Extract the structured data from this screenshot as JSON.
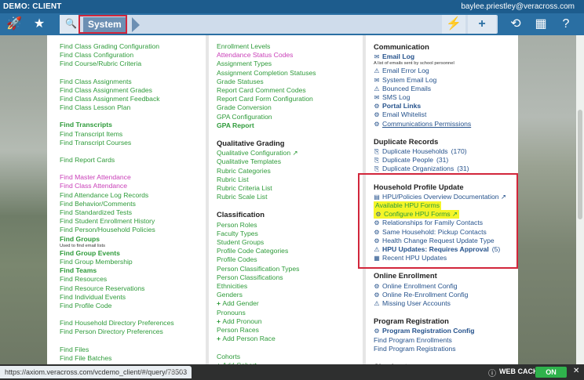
{
  "topbar": {
    "client": "DEMO: CLIENT",
    "user": "baylee.priestley@veracross.com"
  },
  "nav": {
    "left_icons": [
      {
        "name": "rocket-icon",
        "glyph": "🚀"
      },
      {
        "name": "star-icon",
        "glyph": "★"
      }
    ],
    "search_icon": "🔍",
    "system_label": "System",
    "right_buttons": [
      {
        "name": "lightning-icon",
        "glyph": "⚡"
      },
      {
        "name": "plus-icon",
        "glyph": "+"
      }
    ],
    "right_icons": [
      {
        "name": "history-icon",
        "glyph": "⟲"
      },
      {
        "name": "dashboard-grid-icon",
        "glyph": "▦"
      },
      {
        "name": "help-icon",
        "glyph": "?"
      }
    ]
  },
  "col1": [
    {
      "text": "Find Class Grading Configuration"
    },
    {
      "text": "Find Class Configuration"
    },
    {
      "text": "Find Course/Rubric Criteria"
    },
    {
      "gap": true
    },
    {
      "text": "Find Class Assignments"
    },
    {
      "text": "Find Class Assignment Grades"
    },
    {
      "text": "Find Class Assignment Feedback"
    },
    {
      "text": "Find Class Lesson Plan"
    },
    {
      "gap": true
    },
    {
      "text": "Find Transcripts",
      "bold": true
    },
    {
      "text": "Find Transcript Items"
    },
    {
      "text": "Find Transcript Courses"
    },
    {
      "gap": true
    },
    {
      "text": "Find Report Cards"
    },
    {
      "gap": true
    },
    {
      "text": "Find Master Attendance",
      "magenta": true
    },
    {
      "text": "Find Class Attendance",
      "magenta": true
    },
    {
      "text": "Find Attendance Log Records"
    },
    {
      "text": "Find Behavior/Comments"
    },
    {
      "text": "Find Standardized Tests"
    },
    {
      "text": "Find Student Enrollment History"
    },
    {
      "text": "Find Person/Household Policies"
    },
    {
      "text": "Find Groups",
      "bold": true
    },
    {
      "note": "Used to find email lists"
    },
    {
      "text": "Find Group Events",
      "bold": true
    },
    {
      "text": "Find Group Membership"
    },
    {
      "text": "Find Teams",
      "bold": true
    },
    {
      "text": "Find Resources"
    },
    {
      "text": "Find Resource Reservations"
    },
    {
      "text": "Find Individual Events"
    },
    {
      "text": "Find Profile Code"
    },
    {
      "gap": true
    },
    {
      "text": "Find Household Directory Preferences"
    },
    {
      "text": "Find Person Directory Preferences"
    },
    {
      "gap": true
    },
    {
      "text": "Find Files"
    },
    {
      "text": "Find File Batches"
    }
  ],
  "col2": [
    {
      "text": "Enrollment Levels"
    },
    {
      "text": "Attendance Status Codes",
      "magenta": true
    },
    {
      "text": "Assignment Types"
    },
    {
      "text": "Assignment Completion Statuses"
    },
    {
      "text": "Grade Statuses"
    },
    {
      "text": "Report Card Comment Codes"
    },
    {
      "text": "Report Card Form Configuration"
    },
    {
      "text": "Grade Conversion"
    },
    {
      "text": "GPA Configuration"
    },
    {
      "text": "GPA Report",
      "bold": true
    },
    {
      "gap": true
    },
    {
      "header": "Qualitative Grading"
    },
    {
      "text": "Qualitative Configuration",
      "ext": true
    },
    {
      "text": "Qualitative Templates"
    },
    {
      "text": "Rubric Categories"
    },
    {
      "text": "Rubric List"
    },
    {
      "text": "Rubric Criteria List"
    },
    {
      "text": "Rubric Scale List"
    },
    {
      "gap": true
    },
    {
      "header": "Classification"
    },
    {
      "text": "Person Roles"
    },
    {
      "text": "Faculty Types"
    },
    {
      "text": "Student Groups"
    },
    {
      "text": "Profile Code Categories"
    },
    {
      "text": "Profile Codes"
    },
    {
      "text": "Person Classification Types"
    },
    {
      "text": "Person Classifications"
    },
    {
      "text": "Ethnicities"
    },
    {
      "text": "Genders"
    },
    {
      "text": "Add Gender",
      "add": true
    },
    {
      "text": "Pronouns"
    },
    {
      "text": "Add Pronoun",
      "add": true
    },
    {
      "text": "Person Races"
    },
    {
      "text": "Add Person Race",
      "add": true
    },
    {
      "gap": true
    },
    {
      "text": "Cohorts"
    },
    {
      "text": "Add Cohort",
      "add": true
    }
  ],
  "col3": [
    {
      "header": "Communication"
    },
    {
      "text": "Email Log",
      "bold": true,
      "icon": "✉"
    },
    {
      "note": "A list of emails sent by school personnel"
    },
    {
      "text": "Email Error Log",
      "icon": "⚠"
    },
    {
      "text": "System Email Log",
      "icon": "✉"
    },
    {
      "text": "Bounced Emails",
      "icon": "⚠"
    },
    {
      "text": "SMS Log",
      "icon": "✉"
    },
    {
      "text": "Portal Links",
      "bold": true,
      "icon": "⚙"
    },
    {
      "text": "Email Whitelist",
      "icon": "⚙"
    },
    {
      "text": "Communications Permissions",
      "icon": "⚙",
      "underline": true
    },
    {
      "gap": true
    },
    {
      "header": "Duplicate Records"
    },
    {
      "text": "Duplicate Households",
      "icon": "⎘",
      "count": "(170)"
    },
    {
      "text": "Duplicate People",
      "icon": "⎘",
      "count": "(31)"
    },
    {
      "text": "Duplicate Organizations",
      "icon": "⎘",
      "count": "(31)"
    },
    {
      "gap": true
    },
    {
      "header": "Household Profile Update"
    },
    {
      "text": "HPU/Policies Overview Documentation",
      "icon": "▤",
      "ext": true
    },
    {
      "text": "Available HPU Forms",
      "yellow": true
    },
    {
      "text": "Configure HPU Forms",
      "icon": "⚙",
      "ext": true,
      "yellow": true
    },
    {
      "text": "Relationships for Family Contacts",
      "icon": "⚙"
    },
    {
      "text": "Same Household: Pickup Contacts",
      "icon": "⚙"
    },
    {
      "text": "Health Change Request Update Type",
      "icon": "⚙"
    },
    {
      "text": "HPU Updates: Requires Approval",
      "bold": true,
      "icon": "⚠",
      "count": "(5)"
    },
    {
      "text": "Recent HPU Updates",
      "icon": "▦"
    },
    {
      "gap": true
    },
    {
      "header": "Online Enrollment"
    },
    {
      "text": "Online Enrollment Config",
      "icon": "⚙"
    },
    {
      "text": "Online Re-Enrollment Config",
      "icon": "⚙"
    },
    {
      "text": "Missing User Accounts",
      "icon": "⚠"
    },
    {
      "gap": true
    },
    {
      "header": "Program Registration"
    },
    {
      "text": "Program Registration Config",
      "bold": true,
      "icon": "⚙"
    },
    {
      "text": "Find Program Enrollments"
    },
    {
      "text": "Find Program Registrations"
    },
    {
      "gap": true
    },
    {
      "header": "Checkout"
    }
  ],
  "status_bar": {
    "url": "https://axiom.veracross.com/vcdemo_client/#/query/78503",
    "behind_text": "ata",
    "web_cache_label": "WEB CACHE",
    "toggle_label": "ON",
    "close_glyph": "✕"
  },
  "colors": {
    "topbar": "#1d5c8d",
    "nav": "#2a6fa3",
    "link_green": "#2e9b3a",
    "link_blue": "#25528c",
    "magenta": "#c93fb8",
    "highlight": "#f4f528",
    "annotation_red": "#d2263b"
  }
}
